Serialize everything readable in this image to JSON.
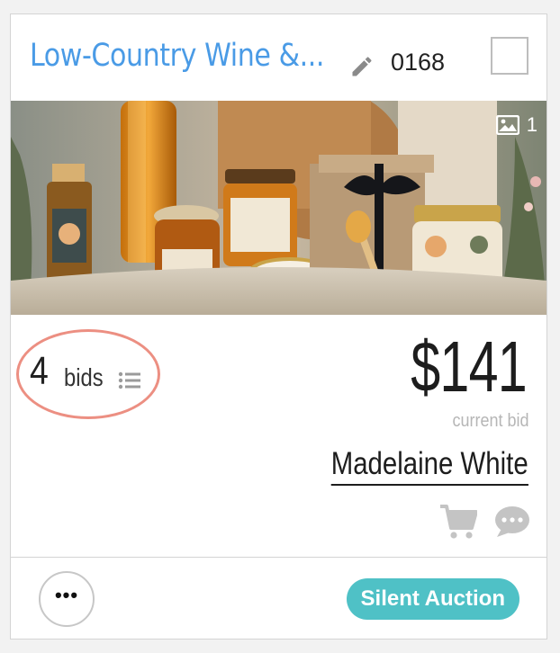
{
  "item": {
    "title": "Low-Country Wine &...",
    "number": "0168",
    "photo_count": "1"
  },
  "bidding": {
    "bid_count": "4",
    "bid_label": "bids",
    "current_bid": "$141",
    "current_bid_caption": "current bid",
    "high_bidder": "Madelaine White"
  },
  "footer": {
    "more_label": "•••",
    "auction_type": "Silent Auction"
  },
  "icons": {
    "edit": "pencil-icon",
    "photo": "image-icon",
    "bids_list": "list-icon",
    "cart": "cart-icon",
    "chat": "chat-icon"
  },
  "colors": {
    "title": "#4a9be6",
    "highlight_oval": "#ec8f82",
    "badge": "#4fc1c6",
    "muted_icon": "#c4c4c4"
  }
}
